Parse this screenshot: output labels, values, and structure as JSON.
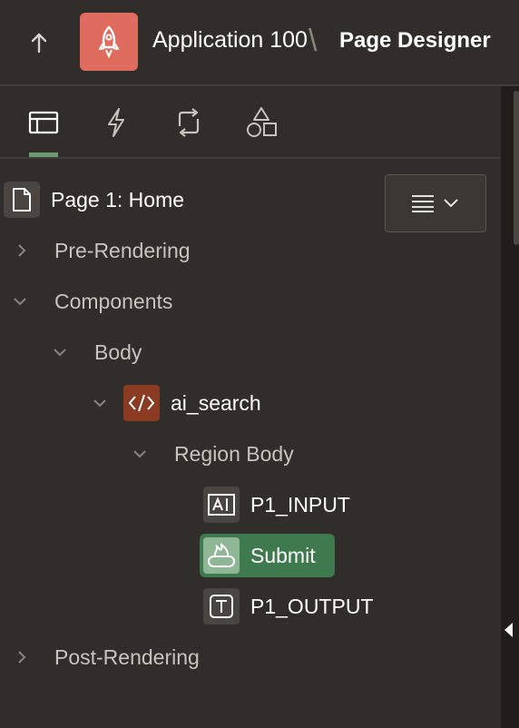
{
  "header": {
    "app_name": "Application 100",
    "separator": "\\",
    "page_designer": "Page Designer",
    "logo_icon": "rocket-icon",
    "logo_color": "#e06b5f"
  },
  "tabs": [
    {
      "name": "rendering",
      "icon": "layout-icon",
      "active": true
    },
    {
      "name": "dynamic-actions",
      "icon": "lightning-icon",
      "active": false
    },
    {
      "name": "processing",
      "icon": "refresh-icon",
      "active": false
    },
    {
      "name": "shared-components",
      "icon": "shapes-icon",
      "active": false
    }
  ],
  "tree": {
    "page_label": "Page 1: Home",
    "pre_rendering": "Pre-Rendering",
    "components": "Components",
    "body": "Body",
    "region": "ai_search",
    "region_body": "Region Body",
    "items": [
      {
        "label": "P1_INPUT",
        "icon": "text-ai-icon"
      },
      {
        "label": "Submit",
        "icon": "button-icon",
        "selected": true
      },
      {
        "label": "P1_OUTPUT",
        "icon": "text-field-icon"
      }
    ],
    "post_rendering": "Post-Rendering"
  },
  "colors": {
    "background": "#312d2a",
    "selected_row": "#3f7a4e",
    "region_icon_bg": "#8a3b21",
    "active_tab_indicator": "#6f9a72"
  }
}
